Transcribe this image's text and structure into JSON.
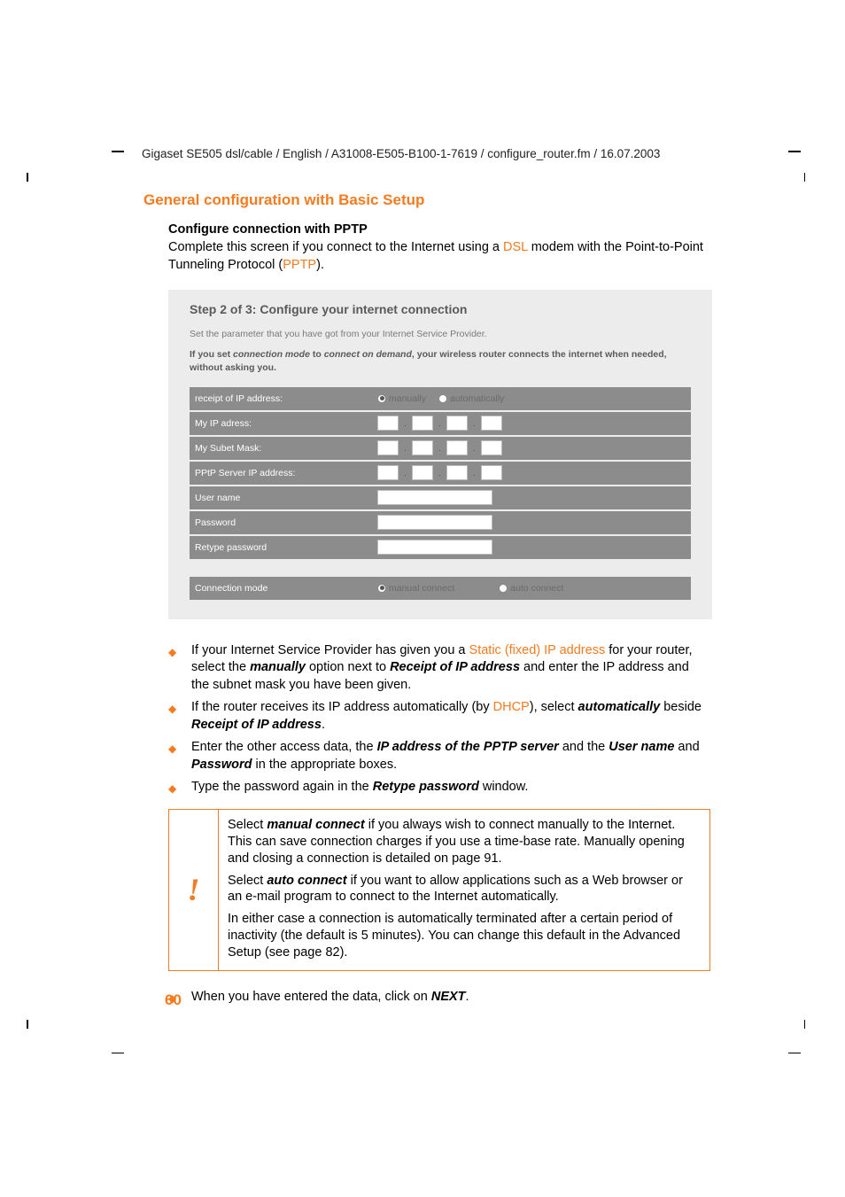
{
  "header_path": "Gigaset SE505 dsl/cable / English / A31008-E505-B100-1-7619 / configure_router.fm / 16.07.2003",
  "section_title": "General configuration with Basic Setup",
  "subhead": "Configure connection with PPTP",
  "intro_before_dsl": "Complete this screen if you connect to the Internet using a ",
  "intro_dsl": "DSL",
  "intro_mid": " modem with the Point-to-Point Tunneling Protocol (",
  "intro_pptp": "PPTP",
  "intro_after": ").",
  "shot": {
    "title": "Step 2 of 3: Configure your internet connection",
    "note": "Set the parameter that you have got from your Internet Service Provider.",
    "warn_a": "If you set ",
    "warn_b": "connection mode",
    "warn_c": " to ",
    "warn_d": "connect on demand",
    "warn_e": ", your wireless router connects the internet when needed, without asking you.",
    "rows": {
      "receipt": "receipt of IP address:",
      "manually": "manually",
      "automatically": "automatically",
      "myip": "My IP adress:",
      "subnet": "My Subet Mask:",
      "pptp_server": "PPtP Server IP address:",
      "user": "User name",
      "password": "Password",
      "retype": "Retype password",
      "conn_mode": "Connection mode",
      "manual_connect": "manual connect",
      "auto_connect": "auto connect"
    }
  },
  "bullets": {
    "b1a": "If your Internet Service Provider has given you a ",
    "b1b": "Static (fixed) IP address",
    "b1c": " for your router, select the ",
    "b1d": "manually",
    "b1e": " option next to ",
    "b1f": "Receipt of IP address",
    "b1g": " and enter the IP address and the subnet mask you have been given.",
    "b2a": "If the router receives its IP address automatically (by ",
    "b2b": "DHCP",
    "b2c": "), select ",
    "b2d": "automatically",
    "b2e": " beside ",
    "b2f": "Receipt of IP address",
    "b2g": ".",
    "b3a": "Enter the other access data, the ",
    "b3b": "IP address of the PPTP server",
    "b3c": " and the ",
    "b3d": "User name",
    "b3e": " and ",
    "b3f": "Password",
    "b3g": " in the appropriate boxes.",
    "b4a": "Type the password again in the ",
    "b4b": "Retype password",
    "b4c": " window."
  },
  "callout": {
    "mark": "!",
    "p1a": "Select ",
    "p1b": "manual connect",
    "p1c": " if you always wish to connect manually to the Internet. This can save connection charges if you use a time-base rate. Manually opening and closing a connection is detailed on page 91.",
    "p2a": "Select ",
    "p2b": "auto connect",
    "p2c": " if you want to allow applications such as a Web browser or an e-mail program to connect to the Internet automatically.",
    "p3": "In either case a connection is automatically terminated after a certain period of inactivity (the default is 5 minutes). You can change this default in the Advanced Setup (see page 82)."
  },
  "final": {
    "a": "When you have entered the data, click on ",
    "b": "NEXT",
    "c": "."
  },
  "page_number": "60"
}
